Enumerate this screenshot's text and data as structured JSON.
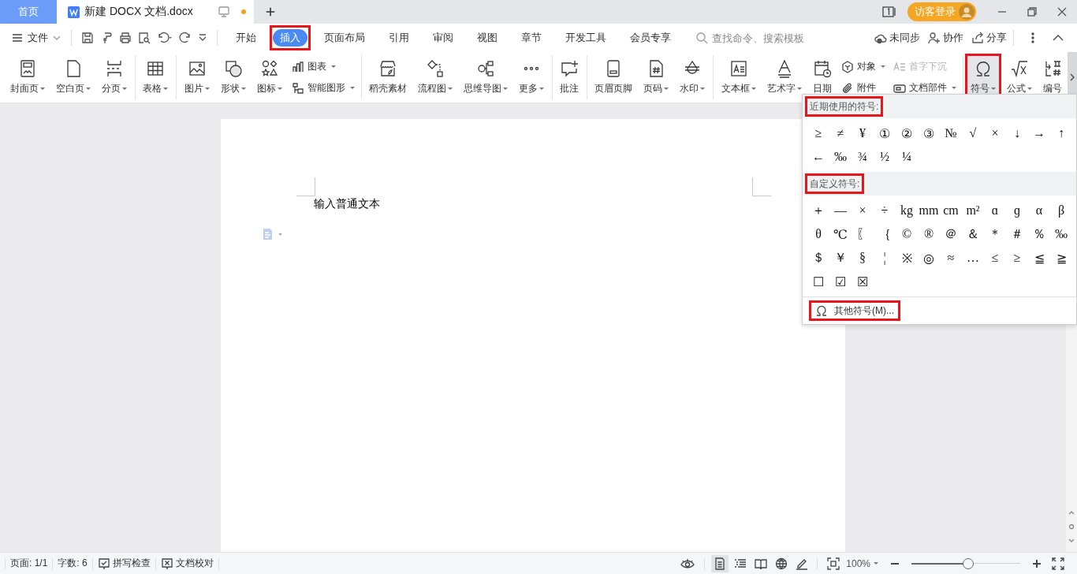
{
  "title_bar": {
    "home_tab": "首页",
    "document_tab": {
      "title": "新建 DOCX 文档.docx",
      "unsaved": true
    },
    "login_button": "访客登录"
  },
  "menu_bar": {
    "file_menu": "文件",
    "tabs": [
      {
        "label": "开始",
        "selected": false,
        "annotated": false
      },
      {
        "label": "插入",
        "selected": true,
        "annotated": true
      },
      {
        "label": "页面布局",
        "selected": false,
        "annotated": false
      },
      {
        "label": "引用",
        "selected": false,
        "annotated": false
      },
      {
        "label": "审阅",
        "selected": false,
        "annotated": false
      },
      {
        "label": "视图",
        "selected": false,
        "annotated": false
      },
      {
        "label": "章节",
        "selected": false,
        "annotated": false
      },
      {
        "label": "开发工具",
        "selected": false,
        "annotated": false
      },
      {
        "label": "会员专享",
        "selected": false,
        "annotated": false
      }
    ],
    "search": {
      "placeholder": "查找命令、搜索模板"
    },
    "actions": [
      "未同步",
      "协作",
      "分享"
    ]
  },
  "ribbon": {
    "groups": [
      {
        "items": [
          {
            "kind": "large",
            "label": "封面页",
            "dropdown": true,
            "pressed": false,
            "annotated": false
          },
          {
            "kind": "large",
            "label": "空白页",
            "dropdown": true,
            "pressed": false,
            "annotated": false
          },
          {
            "kind": "large",
            "label": "分页",
            "dropdown": true,
            "pressed": false,
            "annotated": false
          }
        ]
      },
      {
        "items": [
          {
            "kind": "large",
            "label": "表格",
            "dropdown": true,
            "pressed": false,
            "annotated": false
          }
        ]
      },
      {
        "items": [
          {
            "kind": "large",
            "label": "图片",
            "dropdown": true,
            "pressed": false,
            "annotated": false
          },
          {
            "kind": "large",
            "label": "形状",
            "dropdown": true,
            "pressed": false,
            "annotated": false
          },
          {
            "kind": "large",
            "label": "图标",
            "dropdown": true,
            "pressed": false,
            "annotated": false
          },
          {
            "kind": "stack",
            "items": [
              {
                "label": "图表",
                "dropdown": true,
                "disabled": false
              },
              {
                "label": "智能图形",
                "dropdown": true,
                "disabled": false
              }
            ]
          }
        ]
      },
      {
        "items": [
          {
            "kind": "large",
            "label": "稻壳素材",
            "dropdown": false,
            "pressed": false,
            "annotated": false
          },
          {
            "kind": "large",
            "label": "流程图",
            "dropdown": true,
            "pressed": false,
            "annotated": false
          },
          {
            "kind": "large",
            "label": "思维导图",
            "dropdown": true,
            "pressed": false,
            "annotated": false
          },
          {
            "kind": "large",
            "label": "更多",
            "dropdown": true,
            "pressed": false,
            "annotated": false
          }
        ]
      },
      {
        "items": [
          {
            "kind": "large",
            "label": "批注",
            "dropdown": false,
            "pressed": false,
            "annotated": false
          }
        ]
      },
      {
        "items": [
          {
            "kind": "large",
            "label": "页眉页脚",
            "dropdown": false,
            "pressed": false,
            "annotated": false
          },
          {
            "kind": "large",
            "label": "页码",
            "dropdown": true,
            "pressed": false,
            "annotated": false
          },
          {
            "kind": "large",
            "label": "水印",
            "dropdown": true,
            "pressed": false,
            "annotated": false
          }
        ]
      },
      {
        "items": [
          {
            "kind": "large",
            "label": "文本框",
            "dropdown": true,
            "pressed": false,
            "annotated": false
          },
          {
            "kind": "large",
            "label": "艺术字",
            "dropdown": true,
            "pressed": false,
            "annotated": false
          },
          {
            "kind": "large",
            "label": "日期",
            "dropdown": false,
            "pressed": false,
            "annotated": false
          },
          {
            "kind": "stack",
            "items": [
              {
                "label": "对象",
                "dropdown": true,
                "disabled": false
              },
              {
                "label": "附件",
                "dropdown": false,
                "disabled": false
              }
            ]
          },
          {
            "kind": "stack",
            "items": [
              {
                "label": "首字下沉",
                "dropdown": false,
                "disabled": true
              },
              {
                "label": "文档部件",
                "dropdown": true,
                "disabled": false
              }
            ]
          }
        ]
      },
      {
        "items": [
          {
            "kind": "large",
            "label": "符号",
            "dropdown": true,
            "pressed": true,
            "annotated": true
          },
          {
            "kind": "large",
            "label": "公式",
            "dropdown": true,
            "pressed": false,
            "annotated": false
          },
          {
            "kind": "large",
            "label": "编号",
            "dropdown": false,
            "pressed": false,
            "annotated": false
          }
        ]
      }
    ]
  },
  "symbol_menu": {
    "sections": [
      {
        "title": "近期使用的符号:",
        "annotated": true,
        "symbols": [
          "≥",
          "≠",
          "¥",
          "①",
          "②",
          "③",
          "№",
          "√",
          "×",
          "↓",
          "→",
          "↑",
          "←",
          "‰",
          "¾",
          "½",
          "¼"
        ]
      },
      {
        "title": "自定义符号:",
        "annotated": true,
        "symbols": [
          "＋",
          "—",
          "×",
          "÷",
          "kg",
          "mm",
          "cm",
          "m²",
          "ɑ",
          "ɡ",
          "α",
          "β",
          "θ",
          "℃",
          "〖",
          "｛",
          "©",
          "®",
          "＠",
          "＆",
          "＊",
          "＃",
          "％",
          "‰",
          "＄",
          "￥",
          "§",
          "¦",
          "※",
          "◎",
          "≈",
          "…",
          "≤",
          "≥",
          "≦",
          "≧",
          "☐",
          "☑",
          "☒"
        ]
      }
    ],
    "more": {
      "label": "其他符号(M)...",
      "annotated": true
    }
  },
  "document": {
    "text": "输入普通文本"
  },
  "status_bar": {
    "page": "页面: 1/1",
    "words": "字数: 6",
    "spell_check": "拼写检查",
    "proofread": "文档校对",
    "view_modes": [
      {
        "selected": true
      },
      {
        "selected": false
      },
      {
        "selected": false
      },
      {
        "selected": false
      },
      {
        "selected": false
      }
    ],
    "zoom": "100%",
    "zoom_slider": {
      "level": 0.52
    }
  }
}
